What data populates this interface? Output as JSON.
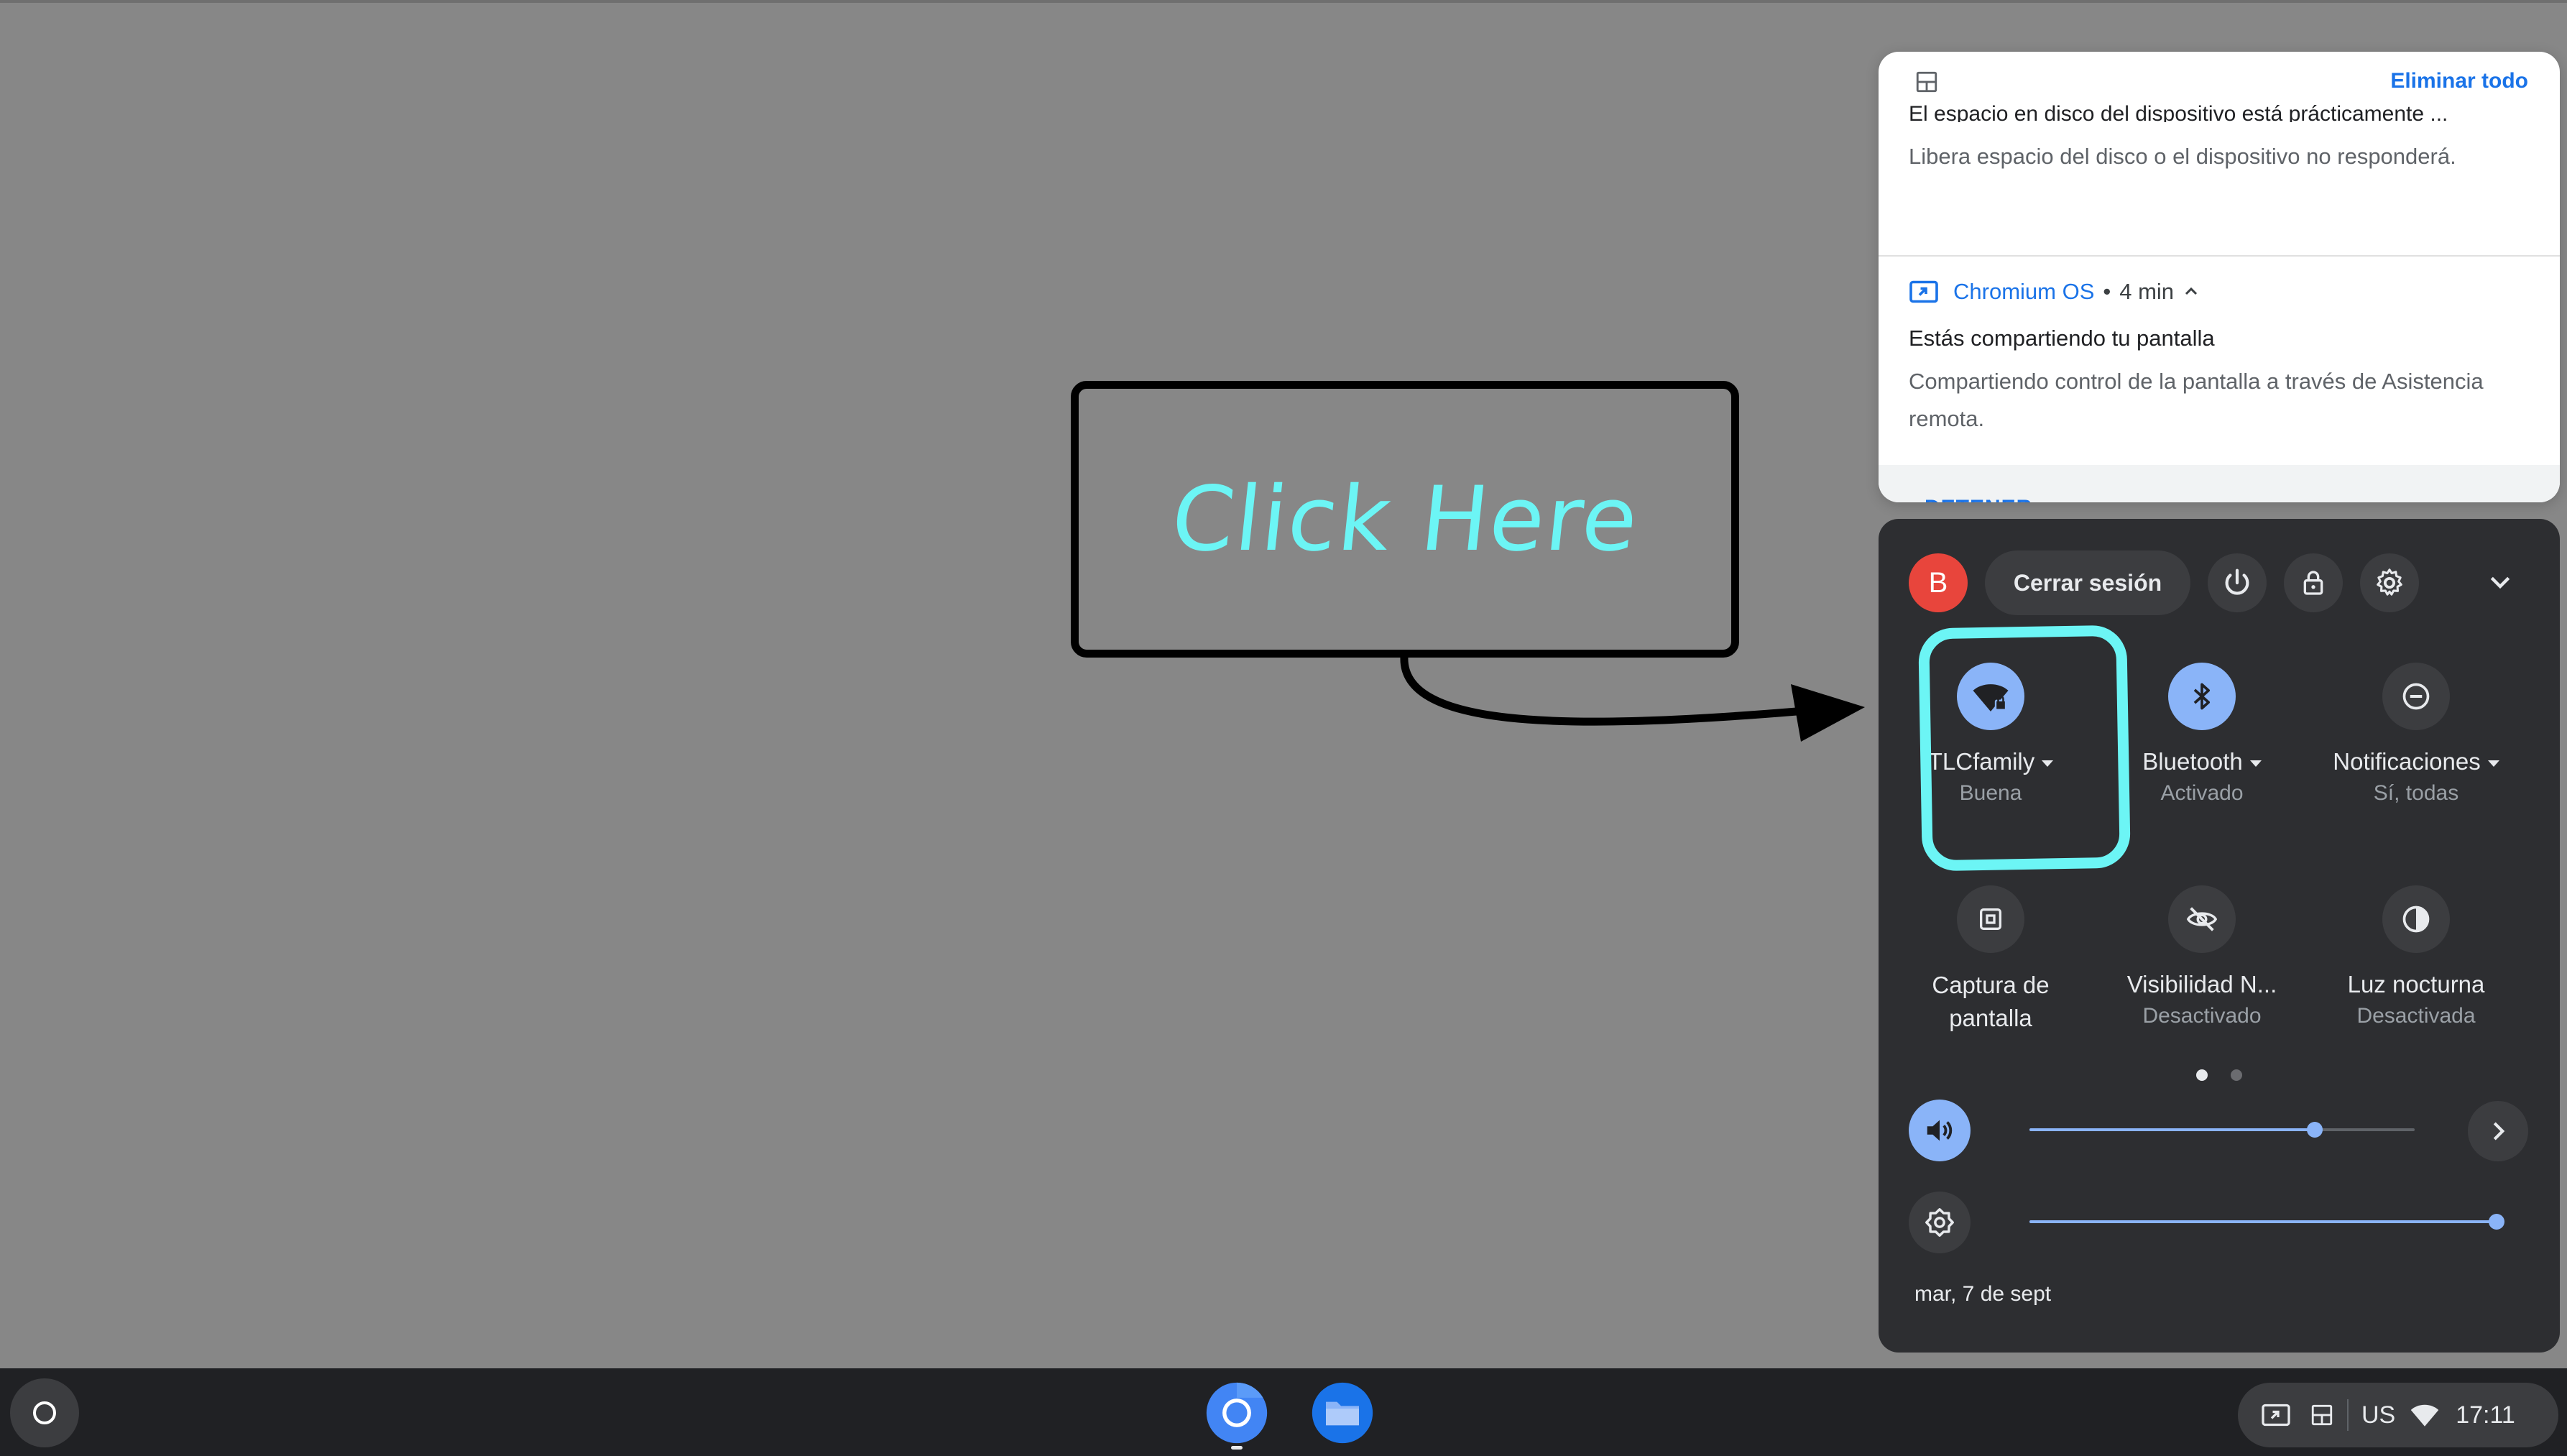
{
  "notifications": {
    "clear_all_label": "Eliminar todo",
    "disk": {
      "icon": "storage-icon",
      "title": "El espacio en disco del dispositivo está prácticamente ...",
      "body": "Libera espacio del disco o el dispositivo no responderá."
    },
    "share": {
      "icon": "cast-screen-icon",
      "app": "Chromium OS",
      "separator": "•",
      "time": "4 min",
      "title": "Estás compartiendo tu pantalla",
      "body": "Compartiendo control de la pantalla a través de Asistencia remota.",
      "action": "DETENER"
    }
  },
  "quick_settings": {
    "avatar_letter": "B",
    "signout_label": "Cerrar sesión",
    "tiles": [
      {
        "label": "TLCfamily",
        "sub": "Buena",
        "has_menu": true,
        "on": true,
        "icon": "wifi-lock-icon"
      },
      {
        "label": "Bluetooth",
        "sub": "Activado",
        "has_menu": true,
        "on": true,
        "icon": "bluetooth-icon"
      },
      {
        "label": "Notificaciones",
        "sub": "Sí, todas",
        "has_menu": true,
        "on": false,
        "icon": "do-not-disturb-icon"
      },
      {
        "label": "Captura de pantalla",
        "sub": "",
        "has_menu": false,
        "on": false,
        "icon": "screen-capture-icon"
      },
      {
        "label": "Visibilidad N...",
        "sub": "Desactivado",
        "has_menu": false,
        "on": false,
        "icon": "visibility-off-icon"
      },
      {
        "label": "Luz nocturna",
        "sub": "Desactivada",
        "has_menu": false,
        "on": false,
        "icon": "night-light-icon"
      }
    ],
    "pages": {
      "count": 2,
      "current": 1
    },
    "volume_level": 0.74,
    "brightness_level": 1.0,
    "date": "mar, 7 de sept"
  },
  "annotation": {
    "callout_text": "Click Here",
    "highlight_color": "#6cf5f5"
  },
  "shelf": {
    "apps": [
      "chrome-icon",
      "files-icon"
    ],
    "tray": {
      "keyboard": "US",
      "time": "17:11"
    }
  },
  "colors": {
    "accent": "#1a73e8",
    "tile_on": "#8ab4f8",
    "avatar": "#e8453c",
    "panel": "#2d2e31",
    "desktop": "#878787"
  }
}
